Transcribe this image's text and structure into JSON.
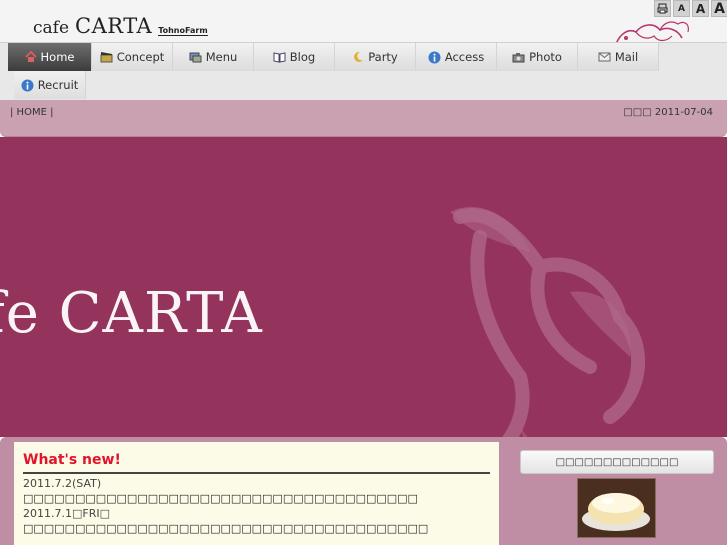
{
  "header": {
    "logo": {
      "part1": "cafe",
      "part2": "CARTA",
      "part3": "TohnoFarm"
    },
    "tools": [
      {
        "name": "print-icon",
        "label": ""
      },
      {
        "name": "font-small-button",
        "label": "A"
      },
      {
        "name": "font-medium-button",
        "label": "A"
      },
      {
        "name": "font-large-button",
        "label": "A"
      }
    ]
  },
  "nav": {
    "items": [
      {
        "label": "Home",
        "icon": "home-icon",
        "active": true
      },
      {
        "label": "Concept",
        "icon": "clapperboard-icon"
      },
      {
        "label": "Menu",
        "icon": "menu-icon"
      },
      {
        "label": "Blog",
        "icon": "book-icon"
      },
      {
        "label": "Party",
        "icon": "moon-icon"
      },
      {
        "label": "Access",
        "icon": "info-icon"
      },
      {
        "label": "Photo",
        "icon": "camera-icon"
      },
      {
        "label": "Mail",
        "icon": "mail-icon"
      },
      {
        "label": "Recruit",
        "icon": "info-icon"
      }
    ]
  },
  "breadcrumb": {
    "text": "| HOME |"
  },
  "update": {
    "label": "□□□",
    "date": "2011-07-04"
  },
  "hero": {
    "title": "fe CARTA"
  },
  "news": {
    "title": "What's new!",
    "entries": [
      {
        "date": "2011.7.2(SAT)",
        "text": "□□□□□□□□□□□□□□□□□□□□□□□□□□□□□□□□□□□□□□"
      },
      {
        "date": "2011.7.1□FRI□",
        "text": "□□□□□□□□□□□□□□□□□□□□□□□□□□□□□□□□□□□□□□□"
      }
    ]
  },
  "sidebar": {
    "box_title": "□□□□□□□□□□□□□"
  },
  "colors": {
    "hero_bg": "#94345c",
    "crumb_bg": "#c9a1b1",
    "content_bg": "#c08ea4",
    "news_title": "#e3132a"
  }
}
